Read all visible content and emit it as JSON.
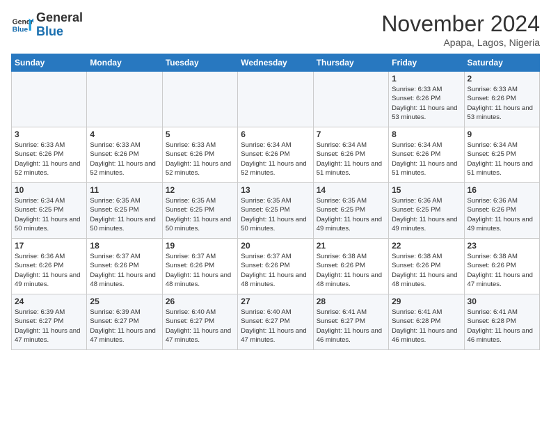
{
  "header": {
    "logo_line1": "General",
    "logo_line2": "Blue",
    "month": "November 2024",
    "location": "Apapa, Lagos, Nigeria"
  },
  "days_of_week": [
    "Sunday",
    "Monday",
    "Tuesday",
    "Wednesday",
    "Thursday",
    "Friday",
    "Saturday"
  ],
  "weeks": [
    [
      {
        "num": "",
        "info": ""
      },
      {
        "num": "",
        "info": ""
      },
      {
        "num": "",
        "info": ""
      },
      {
        "num": "",
        "info": ""
      },
      {
        "num": "",
        "info": ""
      },
      {
        "num": "1",
        "info": "Sunrise: 6:33 AM\nSunset: 6:26 PM\nDaylight: 11 hours and 53 minutes."
      },
      {
        "num": "2",
        "info": "Sunrise: 6:33 AM\nSunset: 6:26 PM\nDaylight: 11 hours and 53 minutes."
      }
    ],
    [
      {
        "num": "3",
        "info": "Sunrise: 6:33 AM\nSunset: 6:26 PM\nDaylight: 11 hours and 52 minutes."
      },
      {
        "num": "4",
        "info": "Sunrise: 6:33 AM\nSunset: 6:26 PM\nDaylight: 11 hours and 52 minutes."
      },
      {
        "num": "5",
        "info": "Sunrise: 6:33 AM\nSunset: 6:26 PM\nDaylight: 11 hours and 52 minutes."
      },
      {
        "num": "6",
        "info": "Sunrise: 6:34 AM\nSunset: 6:26 PM\nDaylight: 11 hours and 52 minutes."
      },
      {
        "num": "7",
        "info": "Sunrise: 6:34 AM\nSunset: 6:26 PM\nDaylight: 11 hours and 51 minutes."
      },
      {
        "num": "8",
        "info": "Sunrise: 6:34 AM\nSunset: 6:26 PM\nDaylight: 11 hours and 51 minutes."
      },
      {
        "num": "9",
        "info": "Sunrise: 6:34 AM\nSunset: 6:25 PM\nDaylight: 11 hours and 51 minutes."
      }
    ],
    [
      {
        "num": "10",
        "info": "Sunrise: 6:34 AM\nSunset: 6:25 PM\nDaylight: 11 hours and 50 minutes."
      },
      {
        "num": "11",
        "info": "Sunrise: 6:35 AM\nSunset: 6:25 PM\nDaylight: 11 hours and 50 minutes."
      },
      {
        "num": "12",
        "info": "Sunrise: 6:35 AM\nSunset: 6:25 PM\nDaylight: 11 hours and 50 minutes."
      },
      {
        "num": "13",
        "info": "Sunrise: 6:35 AM\nSunset: 6:25 PM\nDaylight: 11 hours and 50 minutes."
      },
      {
        "num": "14",
        "info": "Sunrise: 6:35 AM\nSunset: 6:25 PM\nDaylight: 11 hours and 49 minutes."
      },
      {
        "num": "15",
        "info": "Sunrise: 6:36 AM\nSunset: 6:25 PM\nDaylight: 11 hours and 49 minutes."
      },
      {
        "num": "16",
        "info": "Sunrise: 6:36 AM\nSunset: 6:26 PM\nDaylight: 11 hours and 49 minutes."
      }
    ],
    [
      {
        "num": "17",
        "info": "Sunrise: 6:36 AM\nSunset: 6:26 PM\nDaylight: 11 hours and 49 minutes."
      },
      {
        "num": "18",
        "info": "Sunrise: 6:37 AM\nSunset: 6:26 PM\nDaylight: 11 hours and 48 minutes."
      },
      {
        "num": "19",
        "info": "Sunrise: 6:37 AM\nSunset: 6:26 PM\nDaylight: 11 hours and 48 minutes."
      },
      {
        "num": "20",
        "info": "Sunrise: 6:37 AM\nSunset: 6:26 PM\nDaylight: 11 hours and 48 minutes."
      },
      {
        "num": "21",
        "info": "Sunrise: 6:38 AM\nSunset: 6:26 PM\nDaylight: 11 hours and 48 minutes."
      },
      {
        "num": "22",
        "info": "Sunrise: 6:38 AM\nSunset: 6:26 PM\nDaylight: 11 hours and 48 minutes."
      },
      {
        "num": "23",
        "info": "Sunrise: 6:38 AM\nSunset: 6:26 PM\nDaylight: 11 hours and 47 minutes."
      }
    ],
    [
      {
        "num": "24",
        "info": "Sunrise: 6:39 AM\nSunset: 6:27 PM\nDaylight: 11 hours and 47 minutes."
      },
      {
        "num": "25",
        "info": "Sunrise: 6:39 AM\nSunset: 6:27 PM\nDaylight: 11 hours and 47 minutes."
      },
      {
        "num": "26",
        "info": "Sunrise: 6:40 AM\nSunset: 6:27 PM\nDaylight: 11 hours and 47 minutes."
      },
      {
        "num": "27",
        "info": "Sunrise: 6:40 AM\nSunset: 6:27 PM\nDaylight: 11 hours and 47 minutes."
      },
      {
        "num": "28",
        "info": "Sunrise: 6:41 AM\nSunset: 6:27 PM\nDaylight: 11 hours and 46 minutes."
      },
      {
        "num": "29",
        "info": "Sunrise: 6:41 AM\nSunset: 6:28 PM\nDaylight: 11 hours and 46 minutes."
      },
      {
        "num": "30",
        "info": "Sunrise: 6:41 AM\nSunset: 6:28 PM\nDaylight: 11 hours and 46 minutes."
      }
    ]
  ]
}
